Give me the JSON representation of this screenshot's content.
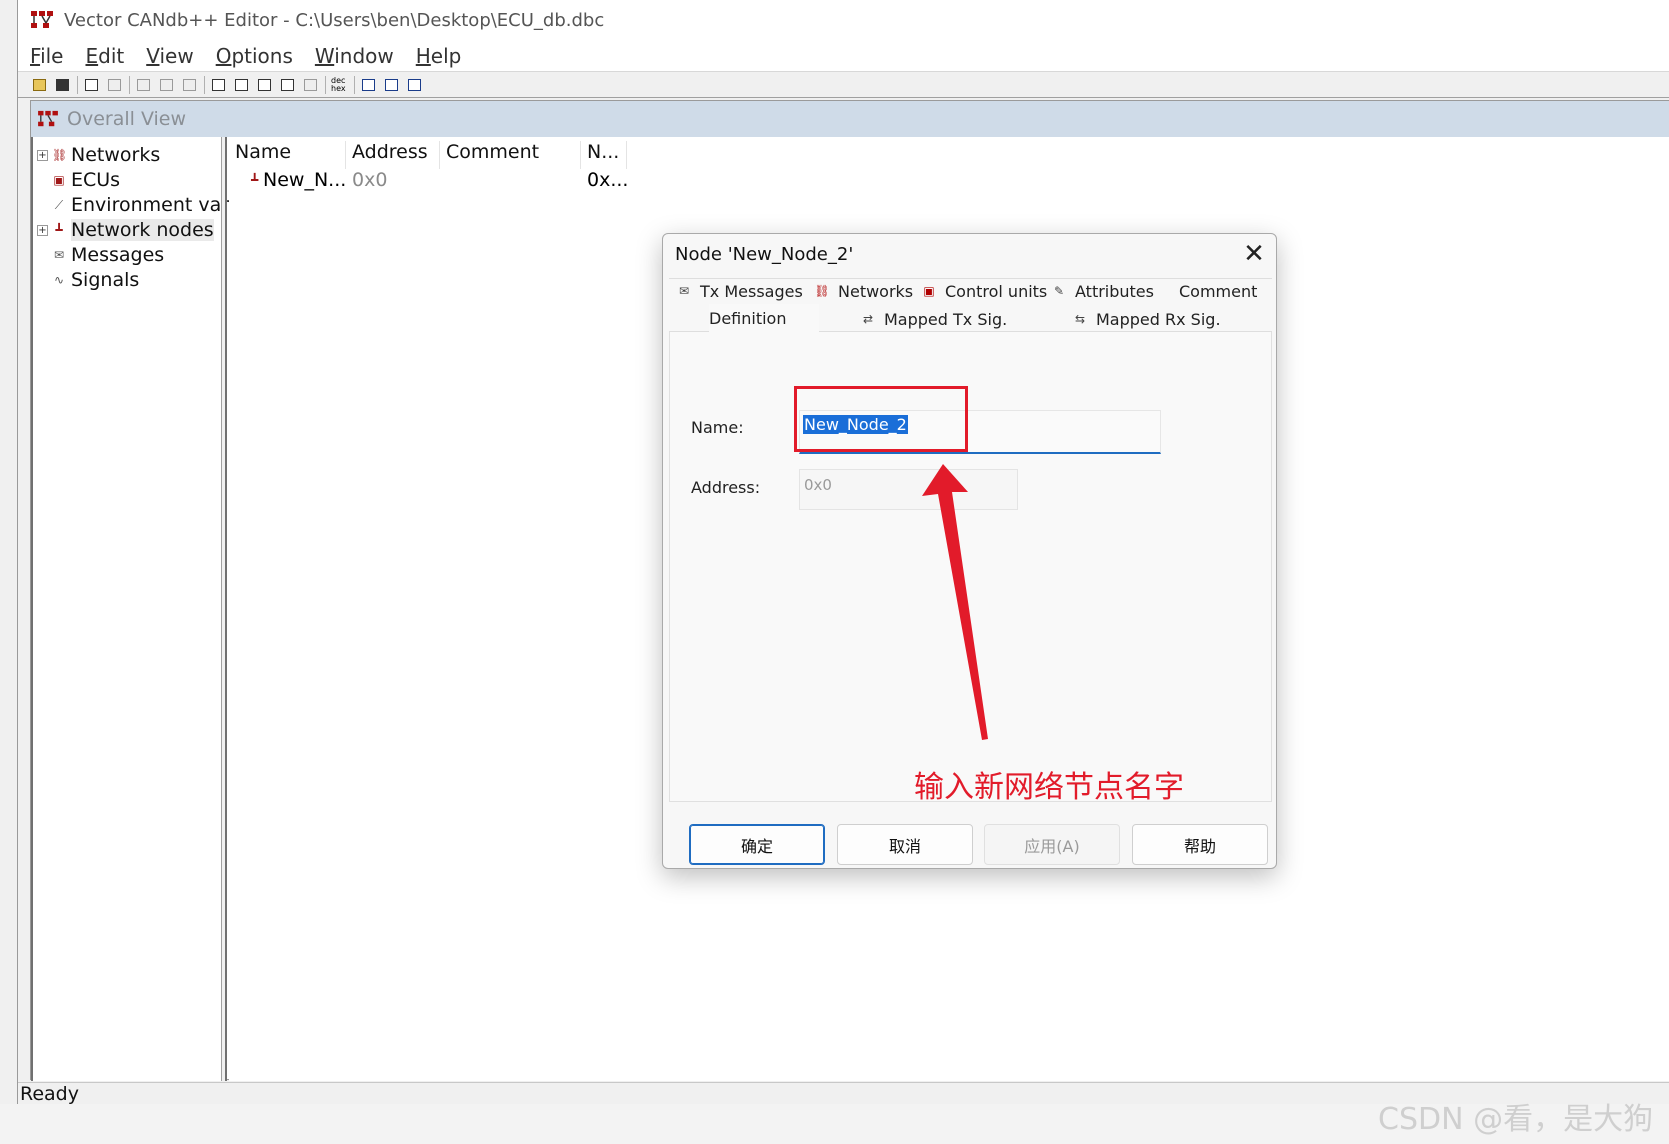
{
  "window": {
    "title": "Vector CANdb++ Editor - C:\\Users\\ben\\Desktop\\ECU_db.dbc"
  },
  "menu": [
    "File",
    "Edit",
    "View",
    "Options",
    "Window",
    "Help"
  ],
  "toolbar": {
    "buttons": [
      "open-icon",
      "save-icon",
      "copy-icon",
      "paste-icon",
      "new-db-icon",
      "properties-icon",
      "print-icon",
      "view-1-icon",
      "view-2-icon",
      "view-3-icon",
      "view-4-icon",
      "view-5-icon",
      "dec-hex-icon",
      "cascade-icon",
      "tile-horizontal-icon",
      "tile-vertical-icon"
    ],
    "dec_hex_label": "dec hex"
  },
  "overall_view": {
    "title": "Overall View",
    "tree": [
      {
        "label": "Networks",
        "expandable": true,
        "icon": "network-icon"
      },
      {
        "label": "ECUs",
        "expandable": false,
        "icon": "ecu-icon"
      },
      {
        "label": "Environment varia",
        "expandable": false,
        "icon": "environment-icon"
      },
      {
        "label": "Network nodes",
        "expandable": true,
        "icon": "node-icon",
        "selected": true
      },
      {
        "label": "Messages",
        "expandable": false,
        "icon": "message-icon"
      },
      {
        "label": "Signals",
        "expandable": false,
        "icon": "signal-icon"
      }
    ],
    "columns": [
      "Name",
      "Address",
      "Comment",
      "N..."
    ],
    "rows": [
      {
        "name": "New_N...",
        "address": "0x0",
        "comment": "",
        "n": "0x..."
      }
    ]
  },
  "status": "Ready",
  "dialog": {
    "title": "Node 'New_Node_2'",
    "tabs_row1": [
      {
        "label": "Tx Messages",
        "icon": "envelope-icon"
      },
      {
        "label": "Networks",
        "icon": "network-icon"
      },
      {
        "label": "Control units",
        "icon": "ecu-icon"
      },
      {
        "label": "Attributes",
        "icon": "attribute-icon"
      },
      {
        "label": "Comment",
        "icon": ""
      }
    ],
    "tabs_row2": [
      {
        "label": "Definition",
        "icon": ""
      },
      {
        "label": "Mapped Tx Sig.",
        "icon": "mapped-tx-icon"
      },
      {
        "label": "Mapped Rx Sig.",
        "icon": "mapped-rx-icon"
      }
    ],
    "name_label": "Name:",
    "name_value": "New_Node_2",
    "address_label": "Address:",
    "address_value": "0x0",
    "buttons": [
      "确定",
      "取消",
      "应用(A)",
      "帮助"
    ]
  },
  "annotation": {
    "text": "输入新网络节点名字",
    "color": "#e21b2a"
  },
  "watermark": "CSDN @看，是大狗"
}
